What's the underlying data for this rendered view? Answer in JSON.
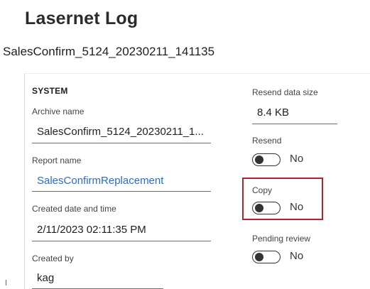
{
  "header": {
    "title": "Lasernet Log",
    "subtitle": "SalesConfirm_5124_20230211_141135"
  },
  "system": {
    "section_label": "SYSTEM",
    "archive_name_label": "Archive name",
    "archive_name_value": "SalesConfirm_5124_20230211_1...",
    "report_name_label": "Report name",
    "report_name_value": "SalesConfirmReplacement",
    "created_label": "Created date and time",
    "created_value": "2/11/2023 02:11:35 PM",
    "created_by_label": "Created by",
    "created_by_value": "kag"
  },
  "right": {
    "resend_size_label": "Resend data size",
    "resend_size_value": "8.4 KB",
    "resend_label": "Resend",
    "resend_state": "No",
    "copy_label": "Copy",
    "copy_state": "No",
    "pending_label": "Pending review",
    "pending_state": "No"
  },
  "colors": {
    "link": "#2a6bd1",
    "highlight": "#b3232f"
  }
}
